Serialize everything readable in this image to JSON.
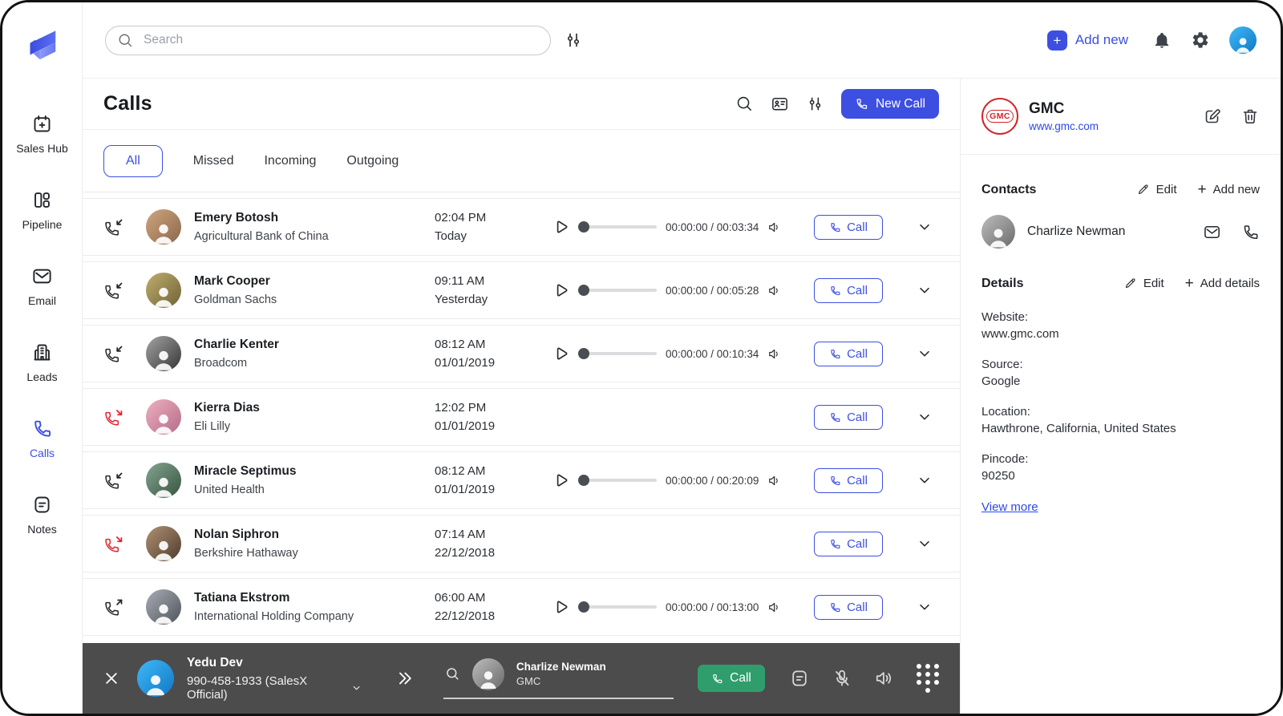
{
  "colors": {
    "primary_blue": "#3D4FE1",
    "link_blue": "#2B49E8",
    "missed_red": "#E0262E",
    "call_green": "#2F9E6C",
    "bottom_bar_gray": "#4C4C4C",
    "gmc_logo_red": "#D2232A"
  },
  "icons": {
    "global_search": "magnifier",
    "filter_sliders": "vertical-sliders",
    "add_new": "plus-badge",
    "notifications": "bell",
    "settings": "gear",
    "contact_card": "id-card",
    "new_call": "phone-handset",
    "incoming_call": "phone-arrow-in",
    "missed_call": "phone-arrow-bounce-red",
    "outgoing_call": "phone-arrow-out",
    "play": "triangle-outline",
    "volume": "speaker",
    "expand_row": "chevron-down",
    "edit": "pencil",
    "edit_company": "pencil-square",
    "delete_company": "trash",
    "contact_email": "envelope",
    "contact_phone": "phone-handset",
    "close_call_bar": "x",
    "expand_call_bar": "double-chevron-right",
    "bar_notes": "note-card",
    "bar_mic": "microphone-muted",
    "bar_speaker": "speaker-loud",
    "bar_dialpad": "dot-grid"
  },
  "sidebar": {
    "items": [
      {
        "label": "Sales Hub",
        "active": false
      },
      {
        "label": "Pipeline",
        "active": false
      },
      {
        "label": "Email",
        "active": false
      },
      {
        "label": "Leads",
        "active": false
      },
      {
        "label": "Calls",
        "active": true
      },
      {
        "label": "Notes",
        "active": false
      }
    ]
  },
  "topbar": {
    "search_placeholder": "Search",
    "add_new_label": "Add new"
  },
  "calls_header": {
    "title": "Calls",
    "new_call_label": "New Call"
  },
  "tabs": {
    "items": [
      {
        "label": "All",
        "active": true
      },
      {
        "label": "Missed",
        "active": false
      },
      {
        "label": "Incoming",
        "active": false
      },
      {
        "label": "Outgoing",
        "active": false
      }
    ]
  },
  "calls": {
    "call_button_label": "Call",
    "rows": [
      {
        "name": "Emery Botosh",
        "company": "Agricultural Bank of China",
        "time": "02:04 PM",
        "date": "Today",
        "direction": "incoming",
        "playback": "00:00:00 / 00:03:34"
      },
      {
        "name": "Mark Cooper",
        "company": "Goldman Sachs",
        "time": "09:11 AM",
        "date": "Yesterday",
        "direction": "incoming",
        "playback": "00:00:00 / 00:05:28"
      },
      {
        "name": "Charlie Kenter",
        "company": "Broadcom",
        "time": "08:12 AM",
        "date": "01/01/2019",
        "direction": "incoming",
        "playback": "00:00:00 / 00:10:34"
      },
      {
        "name": "Kierra Dias",
        "company": "Eli Lilly",
        "time": "12:02 PM",
        "date": "01/01/2019",
        "direction": "missed",
        "playback": null
      },
      {
        "name": "Miracle Septimus",
        "company": "United Health",
        "time": "08:12 AM",
        "date": "01/01/2019",
        "direction": "incoming",
        "playback": "00:00:00 / 00:20:09"
      },
      {
        "name": "Nolan Siphron",
        "company": "Berkshire Hathaway",
        "time": "07:14 AM",
        "date": "22/12/2018",
        "direction": "missed",
        "playback": null
      },
      {
        "name": "Tatiana Ekstrom",
        "company": "International Holding Company",
        "time": "06:00 AM",
        "date": "22/12/2018",
        "direction": "outgoing",
        "playback": "00:00:00 / 00:13:00"
      }
    ]
  },
  "company_panel": {
    "logo_text": "GMC",
    "name": "GMC",
    "website": "www.gmc.com",
    "contacts": {
      "title": "Contacts",
      "edit_label": "Edit",
      "add_new_label": "Add new",
      "items": [
        {
          "name": "Charlize Newman"
        }
      ]
    },
    "details": {
      "title": "Details",
      "edit_label": "Edit",
      "add_label": "Add details",
      "fields": [
        {
          "label": "Website:",
          "value": "www.gmc.com"
        },
        {
          "label": "Source:",
          "value": "Google"
        },
        {
          "label": "Location:",
          "value": "Hawthrone, California, United States"
        },
        {
          "label": "Pincode:",
          "value": "90250"
        }
      ],
      "view_more_label": "View more"
    }
  },
  "call_bar": {
    "agent_name": "Yedu Dev",
    "agent_line": "990-458-1933 (SalesX Official)",
    "callee_name": "Charlize Newman",
    "callee_company": "GMC",
    "call_button_label": "Call"
  }
}
